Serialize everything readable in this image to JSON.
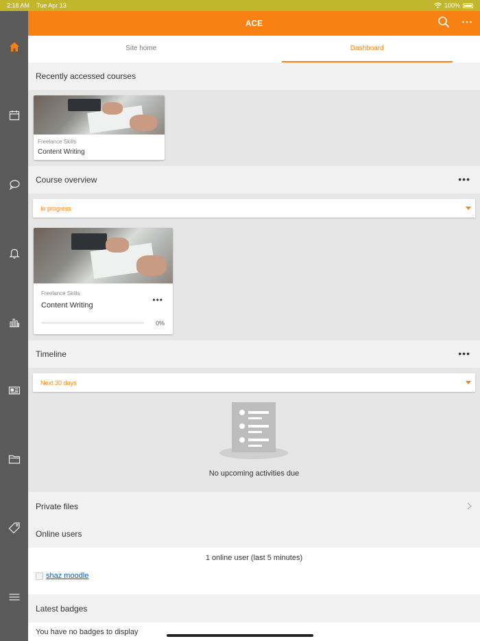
{
  "status_bar": {
    "time": "2:18 AM",
    "date": "Tue Apr 13",
    "battery": "100%"
  },
  "rail": [
    {
      "name": "home-icon",
      "active": true
    },
    {
      "name": "calendar-icon"
    },
    {
      "name": "messages-icon"
    },
    {
      "name": "bell-icon"
    },
    {
      "name": "grades-icon"
    },
    {
      "name": "news-icon"
    },
    {
      "name": "folder-icon"
    },
    {
      "name": "tag-icon"
    },
    {
      "name": "menu-icon"
    }
  ],
  "header": {
    "title": "ACE",
    "accent": "#f98012"
  },
  "tabs": [
    {
      "label": "Site home"
    },
    {
      "label": "Dashboard",
      "active": true
    }
  ],
  "recent": {
    "title": "Recently accessed courses",
    "course": {
      "category": "Freelance Skills",
      "name": "Content Writing"
    }
  },
  "overview": {
    "title": "Course overview",
    "filter": "In progress",
    "course": {
      "category": "Freelance Skills",
      "name": "Content Writing",
      "progress": 0,
      "progress_label": "0%"
    }
  },
  "timeline": {
    "title": "Timeline",
    "filter": "Next 30 days",
    "empty": "No upcoming activities due"
  },
  "private_files": {
    "title": "Private files"
  },
  "online_users": {
    "title": "Online users",
    "summary": "1 online user (last 5 minutes)",
    "user": "shaz moodle"
  },
  "badges": {
    "title": "Latest badges",
    "empty": "You have no badges to display"
  }
}
